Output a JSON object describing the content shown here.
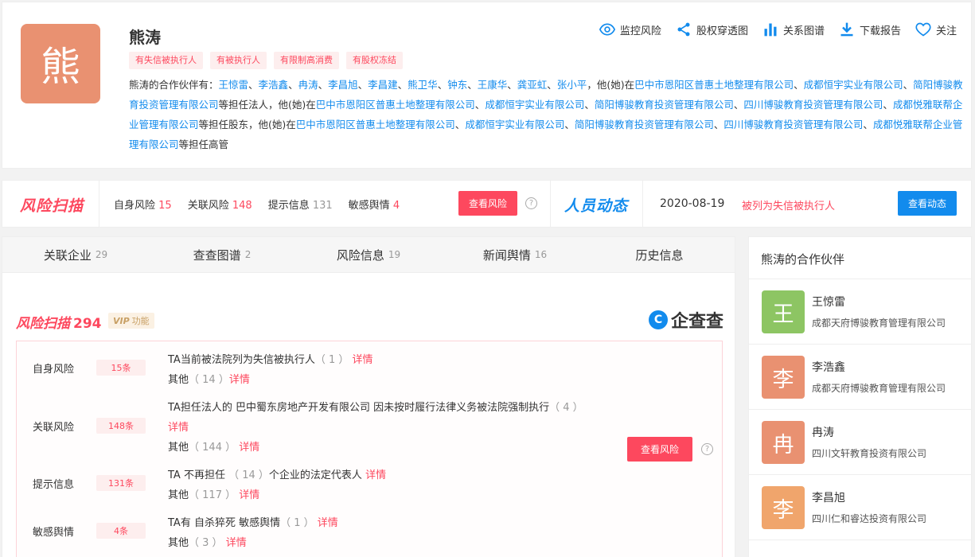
{
  "person": {
    "name": "熊涛",
    "avatar_char": "熊",
    "avatar_color": "#e99171",
    "tags": [
      "有失信被执行人",
      "有被执行人",
      "有限制高消费",
      "有股权冻结"
    ]
  },
  "actions": [
    {
      "label": "监控风险",
      "icon": "eye-icon"
    },
    {
      "label": "股权穿透图",
      "icon": "share-icon"
    },
    {
      "label": "关系图谱",
      "icon": "bar-chart-icon"
    },
    {
      "label": "下载报告",
      "icon": "download-icon"
    },
    {
      "label": "关注",
      "icon": "heart-icon"
    }
  ],
  "partners_line": {
    "intro": "熊涛的合作伙伴有：",
    "partners": [
      "王惊雷",
      "李浩鑫",
      "冉涛",
      "李昌旭",
      "李昌建",
      "熊卫华",
      "钟东",
      "王康华",
      "龚亚虹",
      "张小平"
    ],
    "mid1": "，他(她)在",
    "legal_companies": [
      "巴中市恩阳区普惠土地整理有限公司",
      "成都恒宇实业有限公司",
      "简阳博骏教育投资管理有限公司"
    ],
    "legal_role": "等担任法人，他(她)在",
    "shareholder_companies": [
      "巴中市恩阳区普惠土地整理有限公司",
      "成都恒宇实业有限公司",
      "简阳博骏教育投资管理有限公司",
      "四川博骏教育投资管理有限公司",
      "成都悦雅联帮企业管理有限公司"
    ],
    "shareholder_role": "等担任股东，他(她)在",
    "exec_companies": [
      "巴中市恩阳区普惠土地整理有限公司",
      "成都恒宇实业有限公司",
      "简阳博骏教育投资管理有限公司",
      "四川博骏教育投资管理有限公司",
      "成都悦雅联帮企业管理有限公司"
    ],
    "exec_role": "等担任高管"
  },
  "risk_strip": {
    "logo": "风险扫描",
    "items": [
      {
        "label": "自身风险",
        "count": "15",
        "style": "red"
      },
      {
        "label": "关联风险",
        "count": "148",
        "style": "red"
      },
      {
        "label": "提示信息",
        "count": "131",
        "style": "gray"
      },
      {
        "label": "敏感舆情",
        "count": "4",
        "style": "red"
      }
    ],
    "button": "查看风险",
    "help": "?",
    "people_logo": "人员动态",
    "date": "2020-08-19",
    "event": "被列为失信被执行人",
    "dyn_button": "查看动态"
  },
  "tabs": [
    {
      "label": "关联企业",
      "count": "29"
    },
    {
      "label": "查查图谱",
      "count": "2"
    },
    {
      "label": "风险信息",
      "count": "19"
    },
    {
      "label": "新闻舆情",
      "count": "16"
    },
    {
      "label": "历史信息",
      "count": ""
    }
  ],
  "scan": {
    "title": "风险扫描",
    "count": "294",
    "vip": "VIP",
    "vip_text": "功能",
    "brand": "企查查",
    "brand_mark": "C",
    "button": "查看风险",
    "help": "?",
    "rows": [
      {
        "label": "自身风险",
        "badge": "15条"
      },
      {
        "label": "关联风险",
        "badge": "148条"
      },
      {
        "label": "提示信息",
        "badge": "131条"
      },
      {
        "label": "敏感舆情",
        "badge": "4条"
      }
    ],
    "lines": [
      {
        "text": "TA当前被法院列为失信被执行人",
        "num": "（ 1 ）",
        "detail": "详情"
      },
      {
        "text": "其他",
        "num": "（ 14 ）",
        "detail": "详情"
      },
      {
        "text": "TA担任法人的 巴中蜀东房地产开发有限公司 因未按时履行法律义务被法院强制执行",
        "num": "（ 4 ）",
        "detail": ""
      },
      {
        "text": "",
        "num": "",
        "detail": "详情"
      },
      {
        "text": "其他",
        "num": "（ 144 ）",
        "detail": "详情"
      },
      {
        "text": "TA 不再担任",
        "num": "（ 14 ）",
        "text2": "个企业的法定代表人",
        "detail": "详情"
      },
      {
        "text": "其他",
        "num": "（ 117 ）",
        "detail": "详情"
      },
      {
        "text": "TA有 自杀猝死 敏感舆情",
        "num": "（ 1 ）",
        "detail": "详情"
      },
      {
        "text": "其他",
        "num": "（ 3 ）",
        "detail": "详情"
      }
    ]
  },
  "side": {
    "title": "熊涛的合作伙伴",
    "partners": [
      {
        "char": "王",
        "name": "王惊雷",
        "company": "成都天府博骏教育管理有限公司",
        "color": "#8dc563"
      },
      {
        "char": "李",
        "name": "李浩鑫",
        "company": "成都天府博骏教育管理有限公司",
        "color": "#e99171"
      },
      {
        "char": "冉",
        "name": "冉涛",
        "company": "四川文轩教育投资有限公司",
        "color": "#e99171"
      },
      {
        "char": "李",
        "name": "李昌旭",
        "company": "四川仁和睿达投资有限公司",
        "color": "#f0a56c"
      }
    ]
  }
}
